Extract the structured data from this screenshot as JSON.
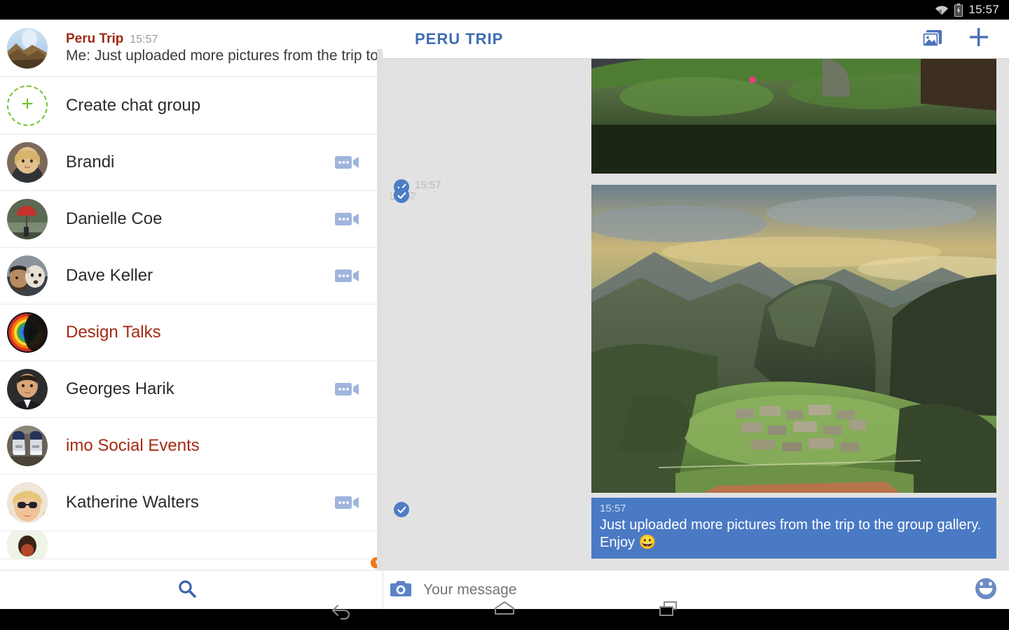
{
  "statusbar": {
    "time": "15:57",
    "icons": [
      "wifi-icon",
      "battery-charging-icon"
    ]
  },
  "sidebar": {
    "active_conversation": {
      "name": "Peru Trip",
      "time": "15:57",
      "snippet": "Me: Just uploaded more pictures from the trip to t..",
      "avatar": "peru-landscape"
    },
    "create_group": {
      "label": "Create chat group",
      "icon": "plus-icon"
    },
    "contacts": [
      {
        "name": "Brandi",
        "type": "person",
        "status": "online",
        "video": true,
        "avatar": "blonde-woman"
      },
      {
        "name": "Danielle Coe",
        "type": "person",
        "status": "away",
        "video": true,
        "avatar": "red-umbrella"
      },
      {
        "name": "Dave Keller",
        "type": "person",
        "status": "online",
        "video": true,
        "avatar": "man-with-dog"
      },
      {
        "name": "Design Talks",
        "type": "group",
        "status": "none",
        "video": false,
        "avatar": "rainbow-swirl"
      },
      {
        "name": "Georges Harik",
        "type": "person",
        "status": "online",
        "video": true,
        "avatar": "man-suit"
      },
      {
        "name": "imo Social Events",
        "type": "group",
        "status": "none",
        "video": false,
        "avatar": "sneakers"
      },
      {
        "name": "Katherine Walters",
        "type": "person",
        "status": "away",
        "video": true,
        "avatar": "woman-sunglasses"
      }
    ]
  },
  "chat": {
    "title": "PERU TRIP",
    "actions": [
      {
        "name": "gallery-icon"
      },
      {
        "name": "plus-icon"
      }
    ],
    "messages": [
      {
        "kind": "image",
        "time": "15:57",
        "delivered": true,
        "alt": "terraced green hillside above a road"
      },
      {
        "kind": "image",
        "time": "15:57",
        "delivered": true,
        "alt": "Machu Picchu ruins at sunset"
      },
      {
        "kind": "text",
        "time": "15:57",
        "delivered": true,
        "text": "Just uploaded more pictures from the trip to the group gallery. Enjoy 😀"
      }
    ]
  },
  "toolbar": {
    "search_icon": "search-icon",
    "camera_icon": "camera-icon",
    "message_placeholder": "Your message",
    "message_value": "",
    "emoji_icon": "emoji-icon"
  },
  "navbar": {
    "buttons": [
      "back-icon",
      "home-icon",
      "recents-icon"
    ]
  },
  "colors": {
    "accent_blue": "#4a7ac4",
    "header_blue": "#3f6db5",
    "group_red": "#a52a12",
    "online_green": "#52c41a",
    "away_orange": "#f07818",
    "chat_bg": "#e2e2e2",
    "dashed_green": "#6fc32c"
  }
}
